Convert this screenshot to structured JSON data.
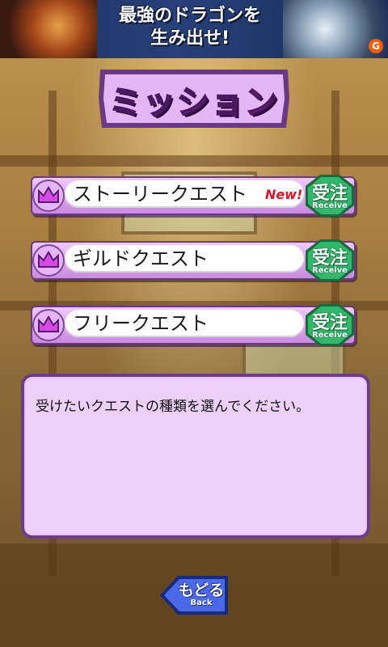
{
  "ad": {
    "line1": "最強のドラゴンを",
    "line2": "生み出せ!",
    "badge": "G"
  },
  "title": "ミッション",
  "quests": [
    {
      "label": "ストーリークエスト",
      "new_tag": "New!",
      "receive_jp": "受注",
      "receive_en": "Receive"
    },
    {
      "label": "ギルドクエスト",
      "new_tag": "",
      "receive_jp": "受注",
      "receive_en": "Receive"
    },
    {
      "label": "フリークエスト",
      "new_tag": "",
      "receive_jp": "受注",
      "receive_en": "Receive"
    }
  ],
  "message": "受けたいクエストの種類を選んでください。",
  "back": {
    "jp": "もどる",
    "en": "Back"
  },
  "colors": {
    "band": "#d9a6ee",
    "receive": "#2fb46a",
    "new": "#e0102a",
    "title": "#ff5af0",
    "back": "#4a64e0"
  }
}
